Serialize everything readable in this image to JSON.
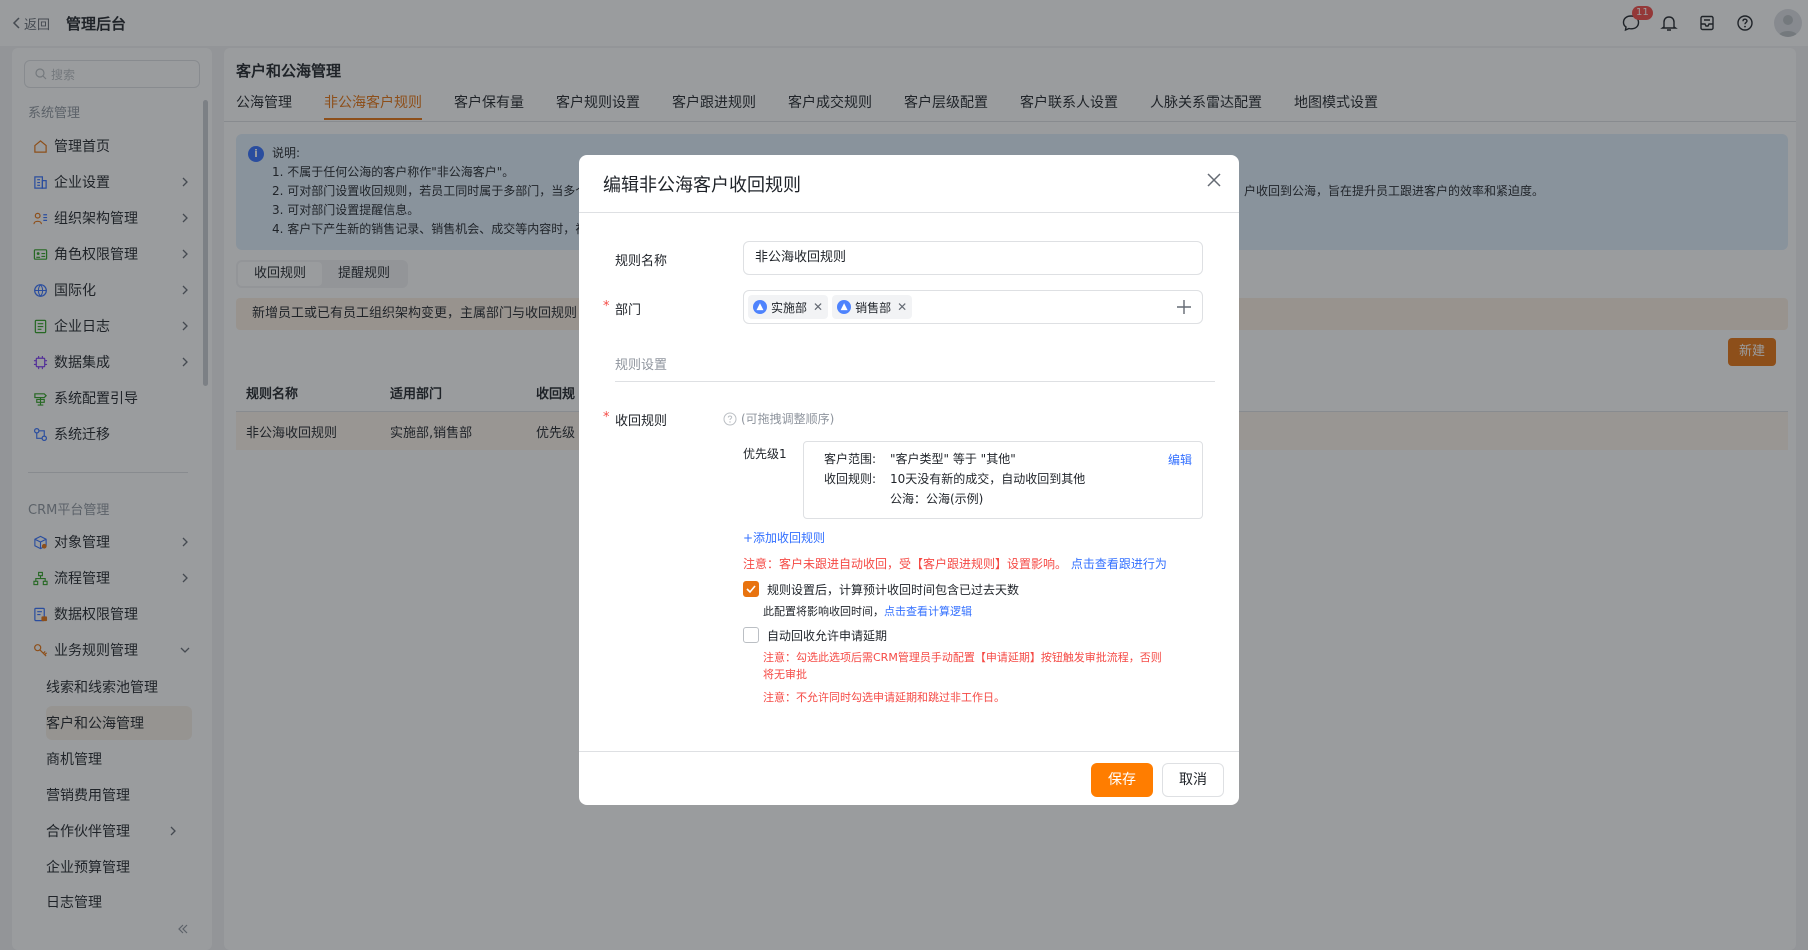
{
  "topbar": {
    "back": "返回",
    "title": "管理后台",
    "notify_count": "11"
  },
  "sidebar": {
    "search_placeholder": "搜索",
    "section1": "系统管理",
    "items1": [
      "管理首页",
      "企业设置",
      "组织架构管理",
      "角色权限管理",
      "国际化",
      "企业日志",
      "数据集成",
      "系统配置引导",
      "系统迁移"
    ],
    "section2": "CRM平台管理",
    "items2": [
      "对象管理",
      "流程管理",
      "数据权限管理",
      "业务规则管理"
    ],
    "subitems": [
      "线索和线索池管理",
      "客户和公海管理",
      "商机管理",
      "营销费用管理",
      "合作伙伴管理",
      "企业预算管理",
      "日志管理"
    ]
  },
  "main": {
    "title": "客户和公海管理",
    "tabs": [
      "公海管理",
      "非公海客户规则",
      "客户保有量",
      "客户规则设置",
      "客户跟进规则",
      "客户成交规则",
      "客户层级配置",
      "客户联系人设置",
      "人脉关系雷达配置",
      "地图模式设置"
    ],
    "info": {
      "title": "说明:",
      "lines": [
        "1. 不属于任何公海的客户称作\"非公海客户\"。",
        "2. 可对部门设置收回规则，若员工同时属于多部门，当多个",
        "3. 可对部门设置提醒信息。",
        "4. 客户下产生新的销售记录、销售机会、成交等内容时，视"
      ],
      "right_text": "户收回到公海，旨在提升员工跟进客户的效率和紧迫度。"
    },
    "seg": [
      "收回规则",
      "提醒规则"
    ],
    "warn": "新增员工或已有员工组织架构变更，主属部门与收回规则",
    "new_btn": "新建",
    "table": {
      "headers": [
        "规则名称",
        "适用部门",
        "收回规"
      ],
      "row": [
        "非公海收回规则",
        "实施部,销售部",
        "优先级"
      ]
    }
  },
  "modal": {
    "title": "编辑非公海客户收回规则",
    "name_label": "规则名称",
    "name_value": "非公海收回规则",
    "dept_label": "部门",
    "dept_tags": [
      "实施部",
      "销售部"
    ],
    "section": "规则设置",
    "rule_label": "收回规则",
    "rule_hint": "(可拖拽调整顺序)",
    "priority": "优先级1",
    "rule_box": {
      "scope_label": "客户范围:",
      "scope_value": "\"客户类型\" 等于 \"其他\"",
      "rule_k": "收回规则:",
      "rule_v": "10天没有新的成交，自动收回到其他",
      "pool": "公海：公海(示例)",
      "edit": "编辑"
    },
    "add_rule": "+添加收回规则",
    "note1_a": "注意：客户未跟进自动收回，受【客户跟进规则】设置影响。",
    "note1_link": "点击查看跟进行为",
    "cb1_label": "规则设置后，计算预计收回时间包含已过去天数",
    "cb1_sub": "此配置将影响收回时间，",
    "cb1_link": "点击查看计算逻辑",
    "cb2_label": "自动回收允许申请延期",
    "cb2_note_l1": "注意：勾选此选项后需CRM管理员手动配置【申请延期】按钮触发审批流程，否则",
    "cb2_note_l2": "将无审批",
    "cb2_note2": "注意：不允许同时勾选申请延期和跳过非工作日。",
    "save": "保存",
    "cancel": "取消"
  },
  "colors": {
    "accent": "#e8730f",
    "primary_btn": "#ff7d00",
    "link": "#3370ff",
    "danger": "#f54a45"
  }
}
